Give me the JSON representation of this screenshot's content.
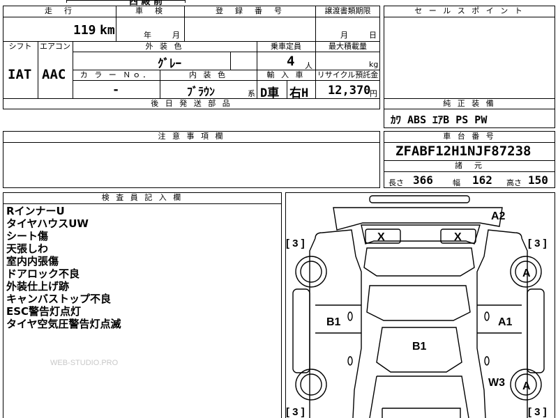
{
  "top_partial": {
    "text": "西 殿 前"
  },
  "mileage": {
    "header": "走　行",
    "value": "119",
    "unit": "km"
  },
  "inspection": {
    "header": "車　検",
    "year_unit": "年",
    "month_unit": "月"
  },
  "registration": {
    "header": "登　録　番　号"
  },
  "transfer_deadline": {
    "header": "譲渡書類期限",
    "month_unit": "月",
    "day_unit": "日"
  },
  "sales_point": {
    "header": "セ ー ル ス ポ イ ン ト"
  },
  "shift": {
    "header": "シフト",
    "value": "IAT"
  },
  "aircon": {
    "header": "エアコン",
    "value": "AAC"
  },
  "exterior_color": {
    "header": "外 装 色",
    "value": "ｸﾞﾚｰ"
  },
  "capacity": {
    "header": "乗車定員",
    "value": "4",
    "unit": "人"
  },
  "max_load": {
    "header": "最大積載量",
    "unit": "kg"
  },
  "color_no": {
    "header": "カ ラ ー Ｎｏ．",
    "value": "-"
  },
  "interior_color": {
    "header": "内 装 色",
    "value": "ﾌﾞﾗｳﾝ",
    "suffix": "系"
  },
  "import_car": {
    "header": "輸 入 車",
    "type": "D車",
    "handle": "右H"
  },
  "recycle_fee": {
    "header": "リサイクル預託金",
    "value": "12,370",
    "unit": "円"
  },
  "later_parts": {
    "header": "後 日 発 送 部 品"
  },
  "equipment": {
    "header": "純 正 装 備",
    "value": "ｶﾜ ABS ｴｱB PS PW"
  },
  "caution": {
    "header": "注 意 事 項 欄"
  },
  "vin": {
    "header": "車 台 番 号",
    "value": "ZFABF12H1NJF87238"
  },
  "specs": {
    "header": "諸　元",
    "length_label": "長さ",
    "length": "366",
    "width_label": "幅",
    "width": "162",
    "height_label": "高さ",
    "height": "150"
  },
  "inspector": {
    "header": "検 査 員 記 入 欄",
    "notes": [
      "RインナーU",
      "タイヤハウスUW",
      "シート傷",
      "天張しわ",
      "室内内張傷",
      "ドアロック不良",
      "外装仕上げ跡",
      "キャンバストップ不良",
      "ESC警告灯点灯",
      "タイヤ空気圧警告灯点滅"
    ]
  },
  "watermark": "WEB-STUDIO.PRO",
  "diagram": {
    "marks": {
      "a2": "A2",
      "x_left": "X",
      "x_right": "X",
      "a_front_right": "A",
      "a_rear_right": "A",
      "b1_left": "B1",
      "a1_right": "A1",
      "b1_center": "B1",
      "w3": "W3"
    },
    "tire_left_front": "[ 3 ]",
    "tire_right_front": "[ 3 ]",
    "tire_left_rear": "[ 3 ]",
    "tire_right_rear": "[ 3 ]"
  }
}
